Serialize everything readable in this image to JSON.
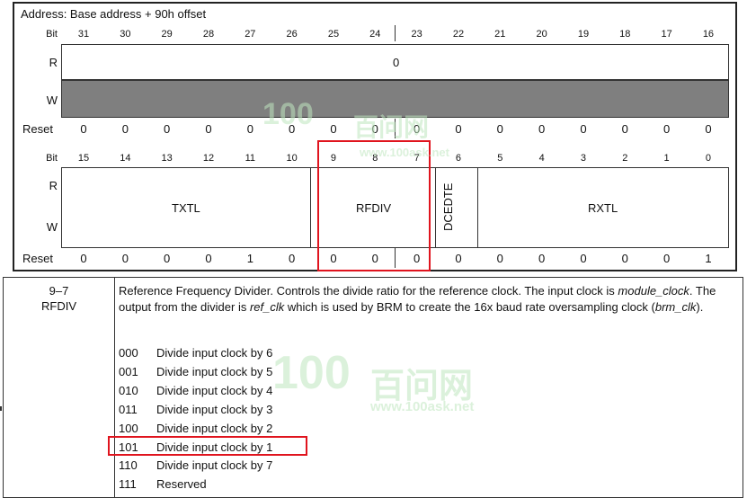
{
  "register": {
    "address": "Address: Base address + 90h offset",
    "bit_label": "Bit",
    "r_label": "R",
    "w_label": "W",
    "reset_label": "Reset",
    "upper": {
      "bits": [
        "31",
        "30",
        "29",
        "28",
        "27",
        "26",
        "25",
        "24",
        "23",
        "22",
        "21",
        "20",
        "19",
        "18",
        "17",
        "16"
      ],
      "r_value": "0",
      "reset": [
        "0",
        "0",
        "0",
        "0",
        "0",
        "0",
        "0",
        "0",
        "0",
        "0",
        "0",
        "0",
        "0",
        "0",
        "0",
        "0"
      ]
    },
    "lower": {
      "bits": [
        "15",
        "14",
        "13",
        "12",
        "11",
        "10",
        "9",
        "8",
        "7",
        "6",
        "5",
        "4",
        "3",
        "2",
        "1",
        "0"
      ],
      "fields": {
        "txtl": "TXTL",
        "rfdiv": "RFDIV",
        "dcedte": "DCEDTE",
        "rxtl": "RXTL"
      },
      "reset": [
        "0",
        "0",
        "0",
        "0",
        "1",
        "0",
        "0",
        "0",
        "0",
        "0",
        "0",
        "0",
        "0",
        "0",
        "0",
        "1"
      ]
    }
  },
  "description": {
    "field_bits": "9–7",
    "field_name": "RFDIV",
    "text": [
      {
        "t": "Reference Frequency Divider. Controls the divide ratio for the reference clock. The input clock is "
      },
      {
        "t": "module_clock",
        "i": true
      },
      {
        "t": ". The output from the divider is "
      },
      {
        "t": "ref_clk",
        "i": true
      },
      {
        "t": " which is used by BRM to create the 16x baud rate oversampling clock ("
      },
      {
        "t": "brm_clk",
        "i": true
      },
      {
        "t": ")."
      }
    ],
    "options": [
      {
        "code": "000",
        "text": "Divide input clock by 6"
      },
      {
        "code": "001",
        "text": "Divide input clock by 5"
      },
      {
        "code": "010",
        "text": "Divide input clock by 4"
      },
      {
        "code": "011",
        "text": "Divide input clock by 3"
      },
      {
        "code": "100",
        "text": "Divide input clock by 2"
      },
      {
        "code": "101",
        "text": "Divide input clock by 1"
      },
      {
        "code": "110",
        "text": "Divide input clock by 7"
      },
      {
        "code": "111",
        "text": "Reserved"
      }
    ],
    "highlighted_option": "101"
  },
  "watermark": {
    "logo": "100",
    "brand": "百问网",
    "url": "www.100ask.net"
  },
  "colors": {
    "highlight": "#e0141e",
    "write_fill": "#7f7f7f",
    "watermark": "#bfe6bf"
  }
}
